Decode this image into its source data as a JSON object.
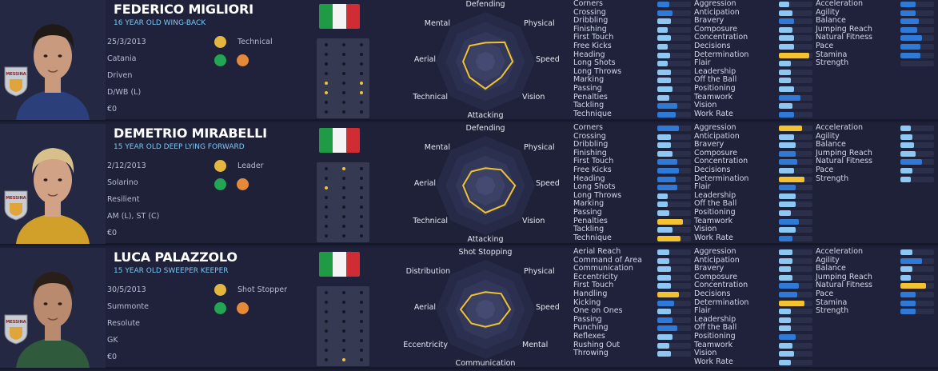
{
  "players": [
    {
      "name": "FEDERICO MIGLIORI",
      "subtitle": "16 YEAR OLD WING-BACK",
      "dob": "25/3/2013",
      "city": "Catania",
      "personality": "Driven",
      "positions": "D/WB (L)",
      "value": "€0",
      "trait": "Technical",
      "trait_icon": "boot-icon",
      "radar_labels": [
        "Defending",
        "Physical",
        "Speed",
        "Vision",
        "Attacking",
        "Technical",
        "Aerial",
        "Mental"
      ],
      "radar_values": [
        0.38,
        0.55,
        0.55,
        0.45,
        0.55,
        0.45,
        0.45,
        0.45
      ],
      "pitch_active": [
        [
          0,
          4
        ],
        [
          0,
          5
        ],
        [
          2,
          4
        ],
        [
          2,
          5
        ]
      ],
      "hair": "#1f1a16",
      "skin": "#c99a7e",
      "shirt": "#2b3f7a",
      "badge_text": "MESSINA",
      "columns": [
        [
          [
            "Corners",
            0.35,
            "blue"
          ],
          [
            "Crossing",
            0.45,
            "blue"
          ],
          [
            "Dribbling",
            0.4,
            "light"
          ],
          [
            "Finishing",
            0.3,
            "light"
          ],
          [
            "First Touch",
            0.4,
            "light"
          ],
          [
            "Free Kicks",
            0.3,
            "light"
          ],
          [
            "Heading",
            0.38,
            "light"
          ],
          [
            "Long Shots",
            0.3,
            "light"
          ],
          [
            "Long Throws",
            0.4,
            "light"
          ],
          [
            "Marking",
            0.4,
            "light"
          ],
          [
            "Passing",
            0.45,
            "light"
          ],
          [
            "Penalties",
            0.35,
            "light"
          ],
          [
            "Tackling",
            0.6,
            "blue"
          ],
          [
            "Technique",
            0.55,
            "blue"
          ]
        ],
        [
          [
            "Aggression",
            0.3,
            "light"
          ],
          [
            "Anticipation",
            0.4,
            "light"
          ],
          [
            "Bravery",
            0.45,
            "blue"
          ],
          [
            "Composure",
            0.4,
            "light"
          ],
          [
            "Concentration",
            0.45,
            "light"
          ],
          [
            "Decisions",
            0.45,
            "light"
          ],
          [
            "Determination",
            0.9,
            "gold"
          ],
          [
            "Flair",
            0.35,
            "light"
          ],
          [
            "Leadership",
            0.35,
            "light"
          ],
          [
            "Off the Ball",
            0.35,
            "light"
          ],
          [
            "Positioning",
            0.45,
            "light"
          ],
          [
            "Teamwork",
            0.65,
            "blue"
          ],
          [
            "Vision",
            0.4,
            "light"
          ],
          [
            "Work Rate",
            0.45,
            "blue"
          ]
        ],
        [
          [
            "Acceleration",
            0.45,
            "blue"
          ],
          [
            "Agility",
            0.45,
            "blue"
          ],
          [
            "Balance",
            0.55,
            "blue"
          ],
          [
            "Jumping Reach",
            0.5,
            "blue"
          ],
          [
            "Natural Fitness",
            0.65,
            "blue"
          ],
          [
            "Pace",
            0.6,
            "blue"
          ],
          [
            "Stamina",
            0.6,
            "blue"
          ],
          [
            "Strength",
            0.0,
            "light"
          ]
        ]
      ]
    },
    {
      "name": "DEMETRIO MIRABELLI",
      "subtitle": "15 YEAR OLD DEEP LYING FORWARD",
      "dob": "2/12/2013",
      "city": "Solarino",
      "personality": "Resilient",
      "positions": "AM (L), ST (C)",
      "value": "€0",
      "trait": "Leader",
      "trait_icon": "captain-armband-icon",
      "radar_labels": [
        "Defending",
        "Physical",
        "Speed",
        "Vision",
        "Attacking",
        "Technical",
        "Aerial",
        "Mental"
      ],
      "radar_values": [
        0.35,
        0.45,
        0.6,
        0.55,
        0.55,
        0.45,
        0.45,
        0.4
      ],
      "pitch_active": [
        [
          1,
          0
        ],
        [
          0,
          2
        ]
      ],
      "hair": "#d8c08a",
      "skin": "#d1a285",
      "shirt": "#d0a02a",
      "badge_text": "MESSINA",
      "columns": [
        [
          [
            "Corners",
            0.65,
            "blue"
          ],
          [
            "Crossing",
            0.4,
            "light"
          ],
          [
            "Dribbling",
            0.4,
            "light"
          ],
          [
            "Finishing",
            0.45,
            "light"
          ],
          [
            "First Touch",
            0.6,
            "blue"
          ],
          [
            "Free Kicks",
            0.65,
            "blue"
          ],
          [
            "Heading",
            0.55,
            "blue"
          ],
          [
            "Long Shots",
            0.6,
            "blue"
          ],
          [
            "Long Throws",
            0.3,
            "light"
          ],
          [
            "Marking",
            0.3,
            "light"
          ],
          [
            "Passing",
            0.35,
            "light"
          ],
          [
            "Penalties",
            0.75,
            "gold"
          ],
          [
            "Tackling",
            0.45,
            "light"
          ],
          [
            "Technique",
            0.7,
            "gold"
          ]
        ],
        [
          [
            "Aggression",
            0.7,
            "gold"
          ],
          [
            "Anticipation",
            0.45,
            "light"
          ],
          [
            "Bravery",
            0.5,
            "light"
          ],
          [
            "Composure",
            0.5,
            "blue"
          ],
          [
            "Concentration",
            0.55,
            "blue"
          ],
          [
            "Decisions",
            0.45,
            "light"
          ],
          [
            "Determination",
            0.75,
            "gold"
          ],
          [
            "Flair",
            0.5,
            "blue"
          ],
          [
            "Leadership",
            0.5,
            "light"
          ],
          [
            "Off the Ball",
            0.5,
            "light"
          ],
          [
            "Positioning",
            0.35,
            "light"
          ],
          [
            "Teamwork",
            0.6,
            "blue"
          ],
          [
            "Vision",
            0.5,
            "light"
          ],
          [
            "Work Rate",
            0.4,
            "blue"
          ]
        ],
        [
          [
            "Acceleration",
            0.3,
            "light"
          ],
          [
            "Agility",
            0.35,
            "light"
          ],
          [
            "Balance",
            0.4,
            "light"
          ],
          [
            "Jumping Reach",
            0.45,
            "light"
          ],
          [
            "Natural Fitness",
            0.65,
            "blue"
          ],
          [
            "Pace",
            0.35,
            "light"
          ],
          [
            "Strength",
            0.3,
            "light"
          ]
        ]
      ]
    },
    {
      "name": "LUCA PALAZZOLO",
      "subtitle": "15 YEAR OLD SWEEPER KEEPER",
      "dob": "30/5/2013",
      "city": "Summonte",
      "personality": "Resolute",
      "positions": "GK",
      "value": "€0",
      "trait": "Shot Stopper",
      "trait_icon": "gloves-icon",
      "radar_labels": [
        "Shot Stopping",
        "Physical",
        "Speed",
        "Mental",
        "Communication",
        "Eccentricity",
        "Aerial",
        "Distribution"
      ],
      "radar_values": [
        0.35,
        0.45,
        0.5,
        0.4,
        0.35,
        0.4,
        0.5,
        0.4
      ],
      "pitch_active": [
        [
          1,
          7
        ]
      ],
      "hair": "#2a1f18",
      "skin": "#b98a6e",
      "shirt": "#2f5a3c",
      "badge_text": "MESSINA",
      "columns": [
        [
          [
            "Aerial Reach",
            0.35,
            "light"
          ],
          [
            "Command of Area",
            0.35,
            "light"
          ],
          [
            "Communication",
            0.4,
            "light"
          ],
          [
            "Eccentricity",
            0.4,
            "light"
          ],
          [
            "First Touch",
            0.4,
            "light"
          ],
          [
            "Handling",
            0.65,
            "gold"
          ],
          [
            "Kicking",
            0.5,
            "blue"
          ],
          [
            "One on Ones",
            0.4,
            "light"
          ],
          [
            "Passing",
            0.45,
            "blue"
          ],
          [
            "Punching",
            0.6,
            "blue"
          ],
          [
            "Reflexes",
            0.45,
            "light"
          ],
          [
            "Rushing Out",
            0.35,
            "light"
          ],
          [
            "Throwing",
            0.4,
            "light"
          ]
        ],
        [
          [
            "Aggression",
            0.4,
            "light"
          ],
          [
            "Anticipation",
            0.4,
            "light"
          ],
          [
            "Bravery",
            0.35,
            "light"
          ],
          [
            "Composure",
            0.4,
            "light"
          ],
          [
            "Concentration",
            0.6,
            "blue"
          ],
          [
            "Decisions",
            0.55,
            "blue"
          ],
          [
            "Determination",
            0.75,
            "gold"
          ],
          [
            "Flair",
            0.35,
            "light"
          ],
          [
            "Leadership",
            0.35,
            "light"
          ],
          [
            "Off the Ball",
            0.35,
            "light"
          ],
          [
            "Positioning",
            0.5,
            "blue"
          ],
          [
            "Teamwork",
            0.4,
            "light"
          ],
          [
            "Vision",
            0.45,
            "light"
          ],
          [
            "Work Rate",
            0.35,
            "light"
          ]
        ],
        [
          [
            "Acceleration",
            0.35,
            "light"
          ],
          [
            "Agility",
            0.65,
            "blue"
          ],
          [
            "Balance",
            0.35,
            "light"
          ],
          [
            "Jumping Reach",
            0.3,
            "light"
          ],
          [
            "Natural Fitness",
            0.75,
            "gold"
          ],
          [
            "Pace",
            0.45,
            "blue"
          ],
          [
            "Stamina",
            0.45,
            "blue"
          ],
          [
            "Strength",
            0.45,
            "blue"
          ]
        ]
      ]
    }
  ],
  "colors": {
    "blue": "#2f7ad6",
    "light": "#8ec7f2",
    "gold": "#f2c230",
    "radar": "#f2c230",
    "flag_green": "#1f9a45",
    "flag_white": "#f4f4f4",
    "flag_red": "#d12b33"
  }
}
